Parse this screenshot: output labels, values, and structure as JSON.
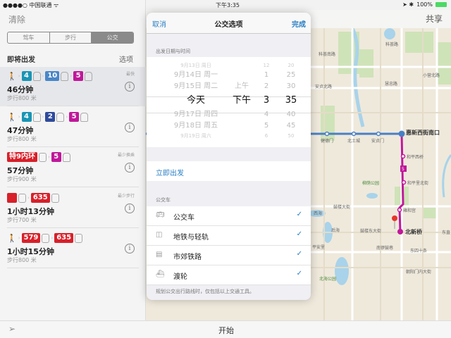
{
  "status": {
    "carrier": "●●●●○ 中国联通 ᯤ",
    "time": "下午3:35",
    "battery": "100%",
    "icons": "➤ ✱"
  },
  "header": {
    "clear": "清除",
    "share": "共享"
  },
  "segments": [
    "驾车",
    "步行",
    "公交"
  ],
  "section": {
    "title": "即将出发",
    "options": "选项"
  },
  "routes": [
    {
      "tag": "最快",
      "duration": "46分钟",
      "walk": "步行800 米",
      "legs": [
        {
          "t": "walk"
        },
        {
          "t": "badge",
          "label": "4",
          "color": "#1a95b5"
        },
        {
          "t": "subway"
        },
        {
          "t": "badge",
          "label": "10",
          "color": "#4a86c8"
        },
        {
          "t": "subway"
        },
        {
          "t": "badge",
          "label": "5",
          "color": "#c0189a"
        },
        {
          "t": "subway"
        }
      ]
    },
    {
      "tag": "",
      "duration": "47分钟",
      "walk": "步行800 米",
      "legs": [
        {
          "t": "walk"
        },
        {
          "t": "badge",
          "label": "4",
          "color": "#1a95b5"
        },
        {
          "t": "subway"
        },
        {
          "t": "badge",
          "label": "2",
          "color": "#2f4b9c"
        },
        {
          "t": "subway"
        },
        {
          "t": "badge",
          "label": "5",
          "color": "#c0189a"
        },
        {
          "t": "subway"
        }
      ]
    },
    {
      "tag": "最少换乘",
      "duration": "57分钟",
      "walk": "步行900 米",
      "legs": [
        {
          "t": "badge",
          "label": "特9内环",
          "color": "#d8202a"
        },
        {
          "t": "bus"
        },
        {
          "t": "badge",
          "label": "5",
          "color": "#c0189a"
        },
        {
          "t": "subway"
        }
      ]
    },
    {
      "tag": "最少步行",
      "duration": "1小时13分钟",
      "walk": "步行700 米",
      "legs": [
        {
          "t": "badge",
          "label": " ",
          "color": "#d8202a"
        },
        {
          "t": "bus"
        },
        {
          "t": "badge",
          "label": "635",
          "color": "#d8202a"
        },
        {
          "t": "bus"
        }
      ]
    },
    {
      "tag": "",
      "duration": "1小时15分钟",
      "walk": "步行800 米",
      "legs": [
        {
          "t": "walk"
        },
        {
          "t": "badge",
          "label": "579",
          "color": "#d8202a"
        },
        {
          "t": "bus"
        },
        {
          "t": "badge",
          "label": "635",
          "color": "#d8202a"
        },
        {
          "t": "bus"
        }
      ]
    }
  ],
  "bottom": {
    "start": "开始"
  },
  "popover": {
    "cancel": "取消",
    "title": "公交选项",
    "done": "完成",
    "date_header": "出发日期与时间",
    "picker": {
      "dates": [
        "9月13日 周日",
        "9月14日 周一",
        "9月15日 周二",
        "今天",
        "9月17日 周四",
        "9月18日 周五",
        "9月19日 周六"
      ],
      "ampm": [
        "",
        "",
        "上午",
        "下午",
        "",
        "",
        ""
      ],
      "hours": [
        "12",
        "1",
        "2",
        "3",
        "4",
        "5",
        "6"
      ],
      "minutes": [
        "20",
        "25",
        "30",
        "35",
        "40",
        "45",
        "50"
      ]
    },
    "leave_now": "立即出发",
    "bus_header": "公交车",
    "modes": [
      {
        "icon": "bus-icon",
        "label": "公交车",
        "checked": true
      },
      {
        "icon": "subway-icon",
        "label": "地铁与轻轨",
        "checked": true
      },
      {
        "icon": "train-icon",
        "label": "市郊铁路",
        "checked": true
      },
      {
        "icon": "ferry-icon",
        "label": "渡轮",
        "checked": true
      }
    ],
    "note": "规划公交出行路线时，仅包括以上交通工具。"
  },
  "map": {
    "labels": [
      "科荟路",
      "科荟南路",
      "安贞北路",
      "小营北路",
      "慧忠路",
      "惠新西街南口",
      "健德门",
      "北土城",
      "安贞门",
      "和平西桥",
      "和平里北街",
      "柳荫公园",
      "鼓楼大街",
      "雍和宫",
      "北新桥",
      "鼓楼东大街",
      "南锣鼓巷",
      "东四十条",
      "朝阳门内大街",
      "北海公园",
      "后海",
      "西海",
      "平安里",
      "东直"
    ],
    "line_badge": "5"
  }
}
